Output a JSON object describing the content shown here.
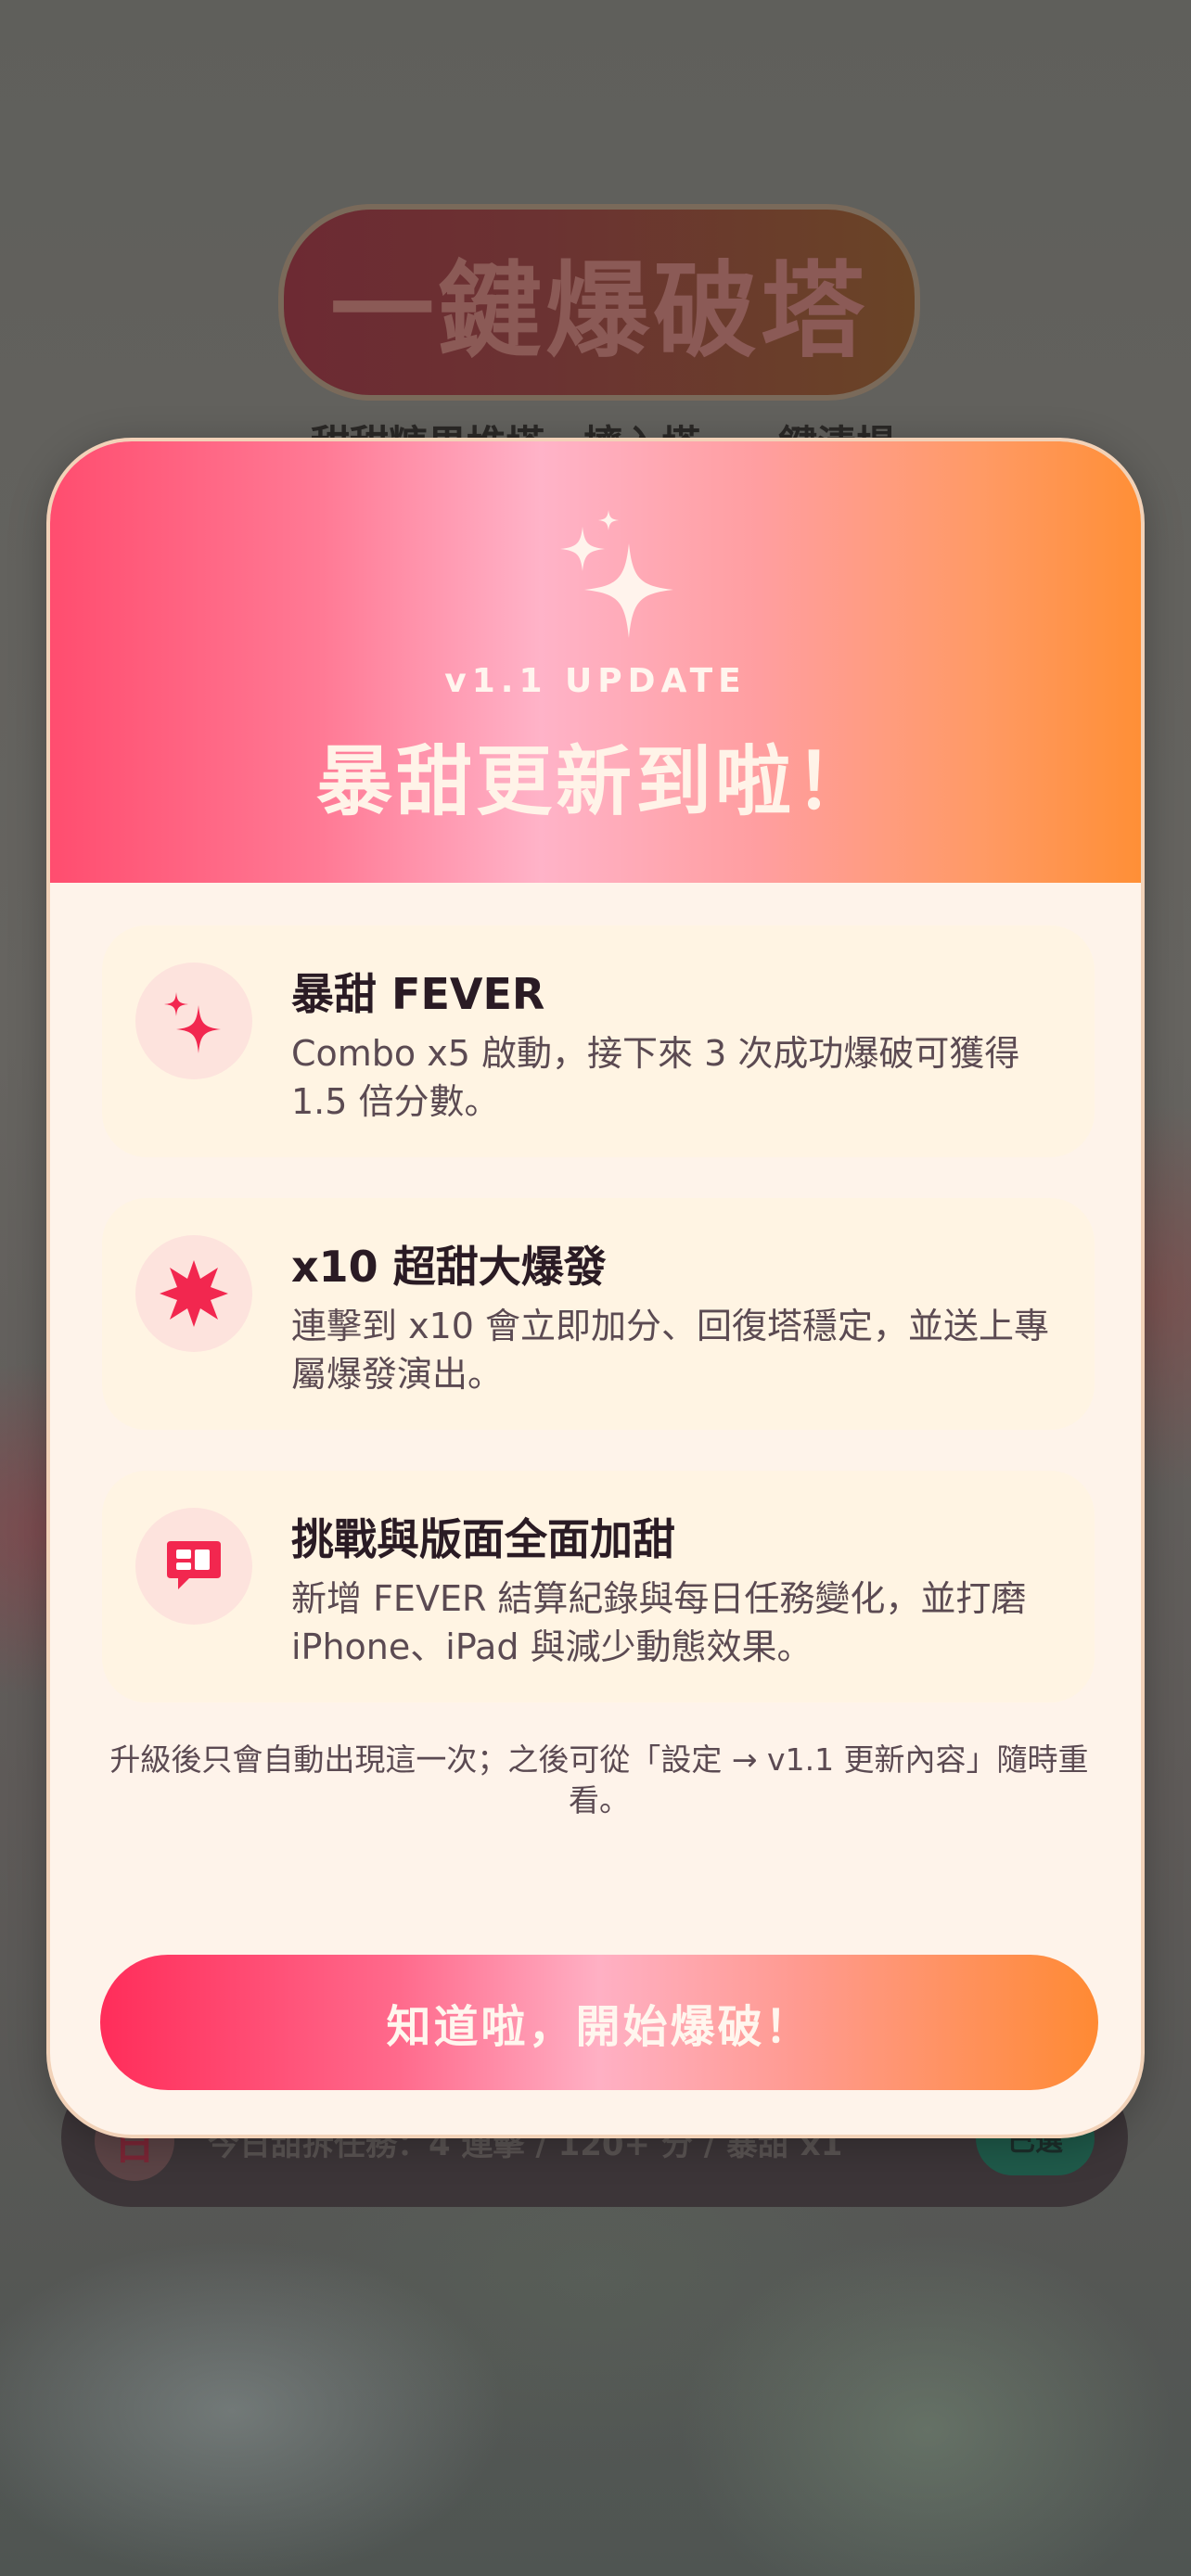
{
  "background": {
    "game_title": "一鍵爆破塔",
    "game_subtitle": "甜甜糖果堆塔，擠入塔，一鍵清場",
    "mission": {
      "icon_text": "日",
      "text": "今日甜拆任務：4 連擊 / 120+ 分 / 暴甜 x1",
      "badge": "已選"
    }
  },
  "modal": {
    "version_tag": "v1.1 UPDATE",
    "title": "暴甜更新到啦！",
    "features": [
      {
        "icon": "sparkles-icon",
        "title": "暴甜 FEVER",
        "description": "Combo x5 啟動，接下來 3 次成功爆破可獲得 1.5 倍分數。"
      },
      {
        "icon": "burst-icon",
        "title": "x10 超甜大爆發",
        "description": "連擊到 x10 會立即加分、回復塔穩定，並送上專屬爆發演出。"
      },
      {
        "icon": "chat-bubble-icon",
        "title": "挑戰與版面全面加甜",
        "description": "新增 FEVER 結算紀錄與每日任務變化，並打磨 iPhone、iPad 與減少動態效果。"
      }
    ],
    "footnote": "升級後只會自動出現這一次；之後可從「設定 → v1.1 更新內容」隨時重看。",
    "confirm_label": "知道啦，開始爆破！"
  },
  "colors": {
    "accent_pink": "#ff2d5a",
    "accent_orange": "#ff8f36",
    "icon_red": "#f2274f",
    "modal_bg": "#fef3ea",
    "card_bg": "#fff4e3"
  }
}
